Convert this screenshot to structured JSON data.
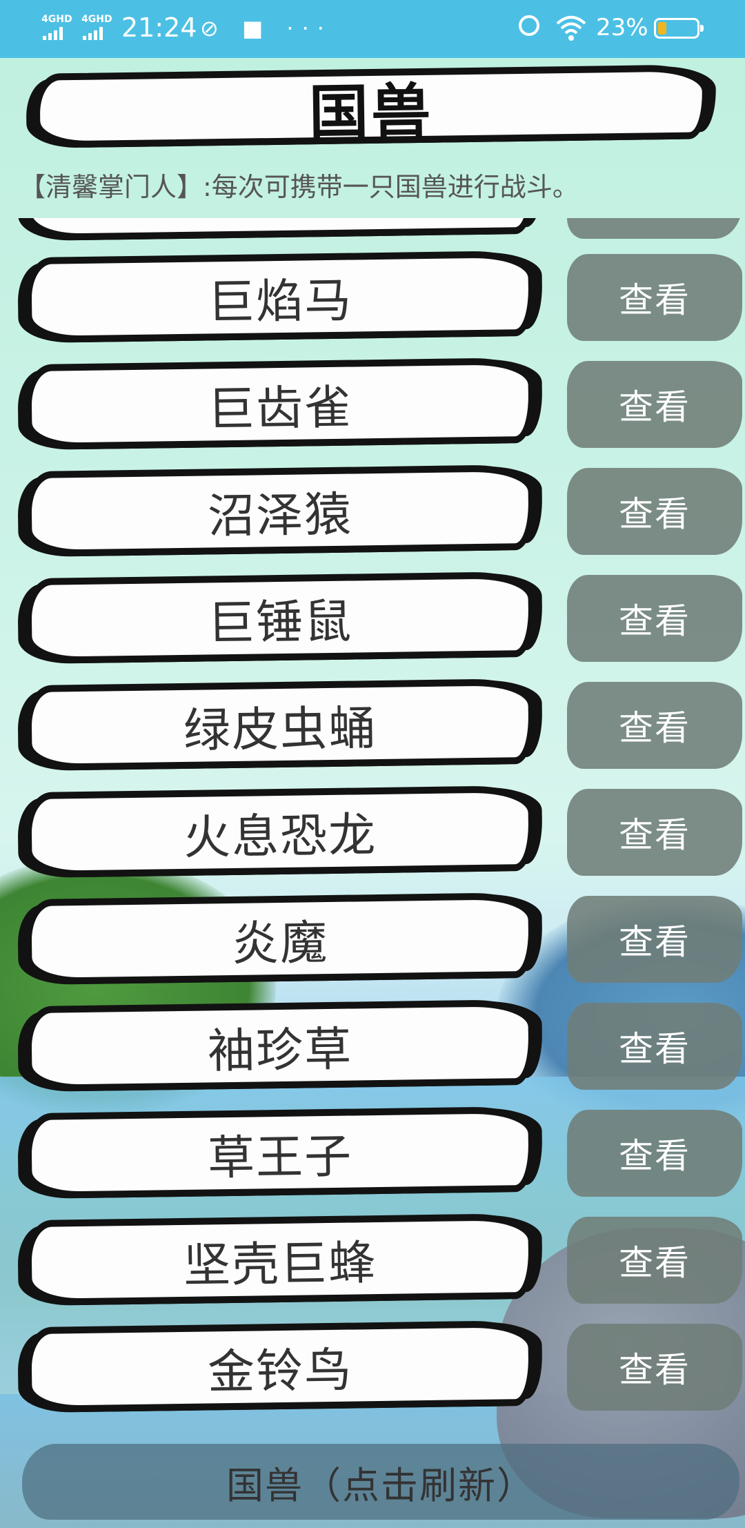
{
  "status_bar": {
    "signal_1": "4GHD",
    "signal_2": "4GHD",
    "time": "21:24",
    "icons_left": "⊘ ■ ···",
    "battery_percent": "23%"
  },
  "header": {
    "title": "国兽"
  },
  "notice": "【清馨掌门人】:每次可携带一只国兽进行战斗。",
  "list": {
    "view_label": "查看",
    "items": [
      {
        "name": ""
      },
      {
        "name": "巨焰马"
      },
      {
        "name": "巨齿雀"
      },
      {
        "name": "沼泽猿"
      },
      {
        "name": "巨锤鼠"
      },
      {
        "name": "绿皮虫蛹"
      },
      {
        "name": "火息恐龙"
      },
      {
        "name": "炎魔"
      },
      {
        "name": "袖珍草"
      },
      {
        "name": "草王子"
      },
      {
        "name": "坚壳巨蜂"
      },
      {
        "name": "金铃鸟"
      }
    ]
  },
  "footer": {
    "refresh_label": "国兽（点击刷新）"
  }
}
